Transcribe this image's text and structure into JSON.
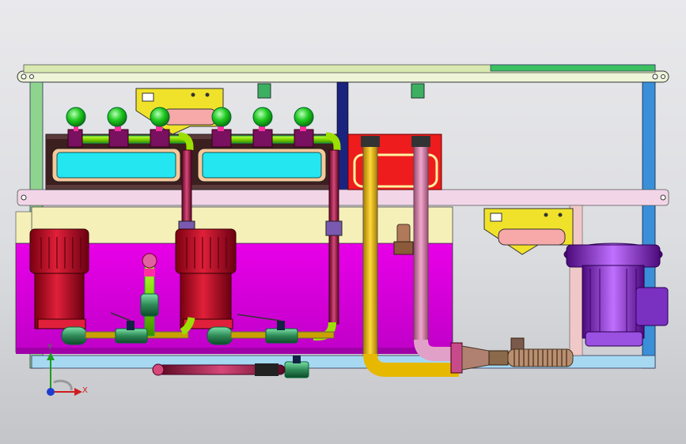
{
  "window": {
    "title": ""
  },
  "triad": {
    "x_label": "X",
    "y_label": "Y"
  },
  "colors": {
    "frame_green": "#7fbf7f",
    "frame_blue": "#3a8fd8",
    "tank_magenta": "#e000e0",
    "tank_cream": "#f4f0b8",
    "motor_red": "#c8102e",
    "valve_green": "#2e8b57",
    "pipe_yellow": "#f5c400",
    "pipe_pink": "#d47aa6",
    "cyan_window": "#24e6f0",
    "bracket_yellow": "#f0e22a",
    "blower_purple": "#8a2be2",
    "gauge_green": "#1ec81e",
    "red_box": "#ee1c1c",
    "navy_post": "#1a237e"
  },
  "components": {
    "gauges": [
      "pressure-gauge-1",
      "pressure-gauge-2",
      "pressure-gauge-3",
      "pressure-gauge-4",
      "pressure-gauge-5",
      "pressure-gauge-6"
    ],
    "pumps": [
      "pump-motor-left",
      "pump-motor-right"
    ],
    "blower": "side-channel-blower"
  }
}
